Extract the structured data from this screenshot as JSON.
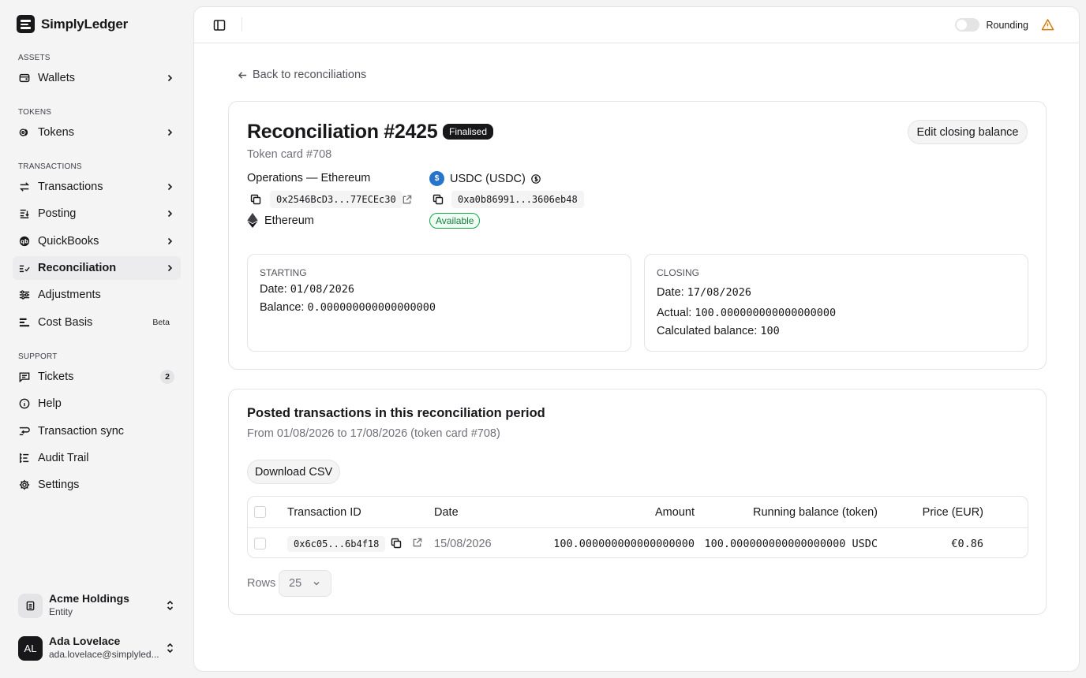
{
  "app": {
    "name": "SimplyLedger"
  },
  "sidebar": {
    "sections": {
      "assets": "Assets",
      "tokens": "Tokens",
      "transactions": "Transactions",
      "support": "Support"
    },
    "items": {
      "wallets": "Wallets",
      "tokens": "Tokens",
      "transactions": "Transactions",
      "posting": "Posting",
      "quickbooks": "QuickBooks",
      "reconciliation": "Reconciliation",
      "adjustments": "Adjustments",
      "cost_basis": "Cost Basis",
      "cost_basis_badge": "Beta",
      "tickets": "Tickets",
      "tickets_count": "2",
      "help": "Help",
      "transaction_sync": "Transaction sync",
      "audit_trail": "Audit Trail",
      "settings": "Settings"
    },
    "entity": {
      "name": "Acme Holdings",
      "type": "Entity"
    },
    "user": {
      "initials": "AL",
      "name": "Ada Lovelace",
      "email": "ada.lovelace@simplyled..."
    }
  },
  "topbar": {
    "rounding_label": "Rounding",
    "rounding_on": false
  },
  "back_link": "Back to reconciliations",
  "reconciliation": {
    "title": "Reconciliation #2425",
    "status": "Finalised",
    "edit_button": "Edit closing balance",
    "token_card": "Token card #708",
    "wallet_label": "Operations — Ethereum",
    "wallet_address": "0x2546BcD3...77ECEc30",
    "chain": "Ethereum",
    "token_name": "USDC (USDC)",
    "token_address": "0xa0b86991...3606eb48",
    "token_status": "Available",
    "starting": {
      "heading": "Starting",
      "date_label": "Date:",
      "date": "01/08/2026",
      "balance_label": "Balance:",
      "balance": "0.000000000000000000"
    },
    "closing": {
      "heading": "Closing",
      "date_label": "Date:",
      "date": "17/08/2026",
      "actual_label": "Actual:",
      "actual": "100.000000000000000000",
      "calculated_label": "Calculated balance:",
      "calculated": "100"
    }
  },
  "posted": {
    "title": "Posted transactions in this reconciliation period",
    "subtitle": "From 01/08/2026 to 17/08/2026 (token card #708)",
    "download_button": "Download CSV",
    "columns": {
      "id": "Transaction ID",
      "date": "Date",
      "amount": "Amount",
      "running": "Running balance (token)",
      "price": "Price (EUR)"
    },
    "rows": [
      {
        "id": "0x6c05...6b4f18",
        "date": "15/08/2026",
        "amount": "100.000000000000000000",
        "running": "100.000000000000000000 USDC",
        "price": "€0.86"
      }
    ],
    "rows_label": "Rows",
    "rows_per_page": "25"
  },
  "icons": {
    "sidebar_toggle": "panel-left-icon",
    "warning": "alert-triangle-icon",
    "copy": "copy-icon",
    "external": "external-link-icon",
    "chain": "ethereum-icon"
  },
  "colors": {
    "accent": "#18181b",
    "available": "#16a34a",
    "warning": "#d97706",
    "usdc": "#2775ca"
  }
}
